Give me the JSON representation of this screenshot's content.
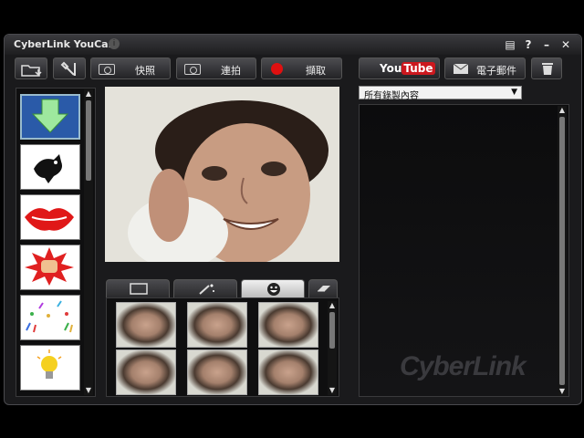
{
  "window": {
    "title": "CyberLink YouCam"
  },
  "toolbar": {
    "snapshot_label": "快照",
    "burst_label": "連拍",
    "record_label": "擷取",
    "email_label": "電子郵件"
  },
  "youtube": {
    "you": "You",
    "tube": "Tube"
  },
  "library": {
    "filter_value": "所有錄製內容"
  },
  "watermark": "CyberLink",
  "icons": {
    "left_thumbs": [
      "download-arrow-icon",
      "bird-silhouette-icon",
      "lips-icon",
      "fist-punch-icon",
      "confetti-icon",
      "light-bulb-icon"
    ]
  },
  "colors": {
    "accent_red": "#e01010",
    "youtube_red": "#cc181e"
  }
}
